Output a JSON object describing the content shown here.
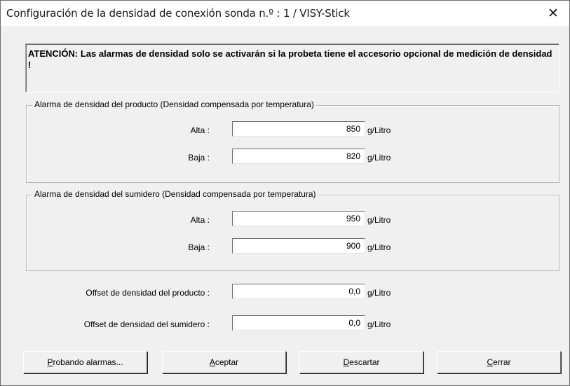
{
  "window": {
    "title": "Configuración de la densidad de conexión sonda n.º : 1 / VISY-Stick",
    "close_glyph": "✕"
  },
  "warning": "ATENCIÓN: Las alarmas de densidad solo se activarán si la probeta tiene el accesorio opcional de medición de densidad !",
  "product_group": {
    "title": "Alarma de densidad del producto (Densidad compensada por temperatura)",
    "high_label": "Alta :",
    "high_value": "850",
    "low_label": "Baja :",
    "low_value": "820",
    "unit": "g/Litro"
  },
  "sump_group": {
    "title": "Alarma de densidad del sumidero (Densidad compensada por temperatura)",
    "high_label": "Alta :",
    "high_value": "950",
    "low_label": "Baja :",
    "low_value": "900",
    "unit": "g/Litro"
  },
  "offsets": {
    "product_label": "Offset de densidad del producto :",
    "product_value": "0,0",
    "sump_label": "Offset de densidad del sumidero :",
    "sump_value": "0,0",
    "unit": "g/Litro"
  },
  "buttons": {
    "test_first": "P",
    "test_rest": "robando alarmas...",
    "accept_first": "A",
    "accept_rest": "ceptar",
    "discard_first": "D",
    "discard_rest": "escartar",
    "close_first": "C",
    "close_rest": "errar"
  }
}
